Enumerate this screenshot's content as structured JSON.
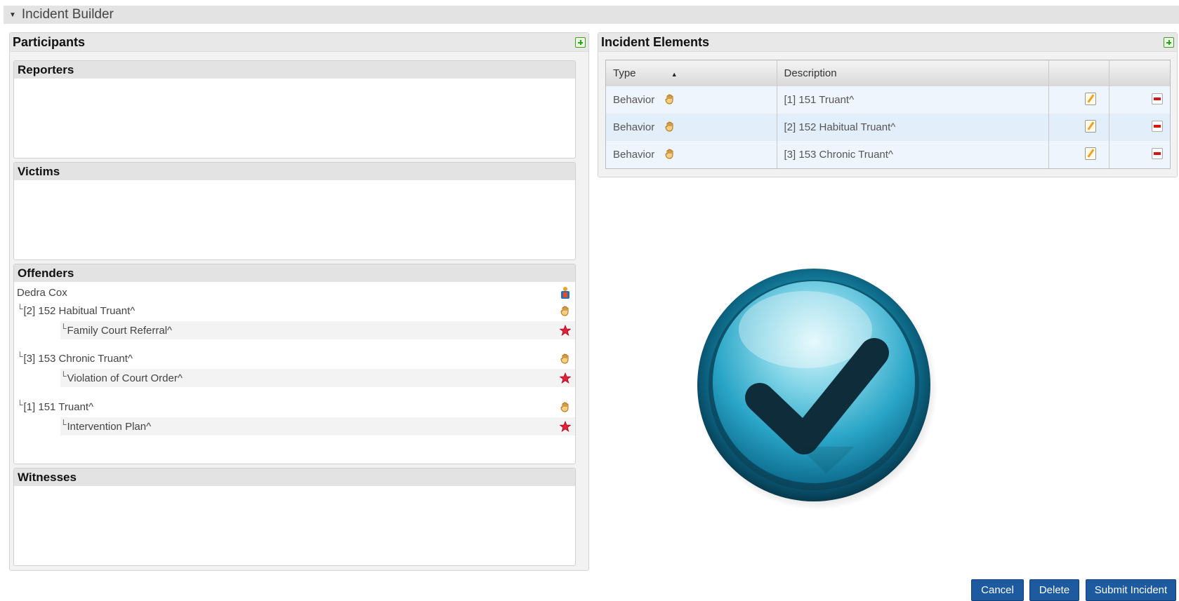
{
  "header": {
    "title": "Incident Builder"
  },
  "participants": {
    "title": "Participants",
    "reporters": {
      "title": "Reporters"
    },
    "victims": {
      "title": "Victims"
    },
    "offenders": {
      "title": "Offenders",
      "name": "Dedra Cox",
      "items": [
        {
          "behavior": "[2] 152 Habitual Truant^",
          "action": "Family Court Referral^"
        },
        {
          "behavior": "[3] 153 Chronic Truant^",
          "action": "Violation of Court Order^"
        },
        {
          "behavior": "[1] 151 Truant^",
          "action": "Intervention Plan^"
        }
      ]
    },
    "witnesses": {
      "title": "Witnesses"
    }
  },
  "elements": {
    "title": "Incident Elements",
    "columns": {
      "type": "Type",
      "description": "Description"
    },
    "sort_indicator": "▲",
    "rows": [
      {
        "type": "Behavior",
        "description": "[1] 151 Truant^"
      },
      {
        "type": "Behavior",
        "description": "[2] 152 Habitual Truant^"
      },
      {
        "type": "Behavior",
        "description": "[3] 153 Chronic Truant^"
      }
    ]
  },
  "buttons": {
    "cancel": "Cancel",
    "delete": "Delete",
    "submit": "Submit Incident"
  },
  "icons": {
    "add": "add-icon",
    "hand": "hand-icon",
    "star": "star-icon",
    "edit": "edit-icon",
    "remove": "remove-icon",
    "person": "person-icon",
    "success": "checkmark-icon"
  },
  "colors": {
    "button": "#1d5aa0",
    "header_bg": "#e3e3e3",
    "row_alt": "#e3eefb"
  }
}
